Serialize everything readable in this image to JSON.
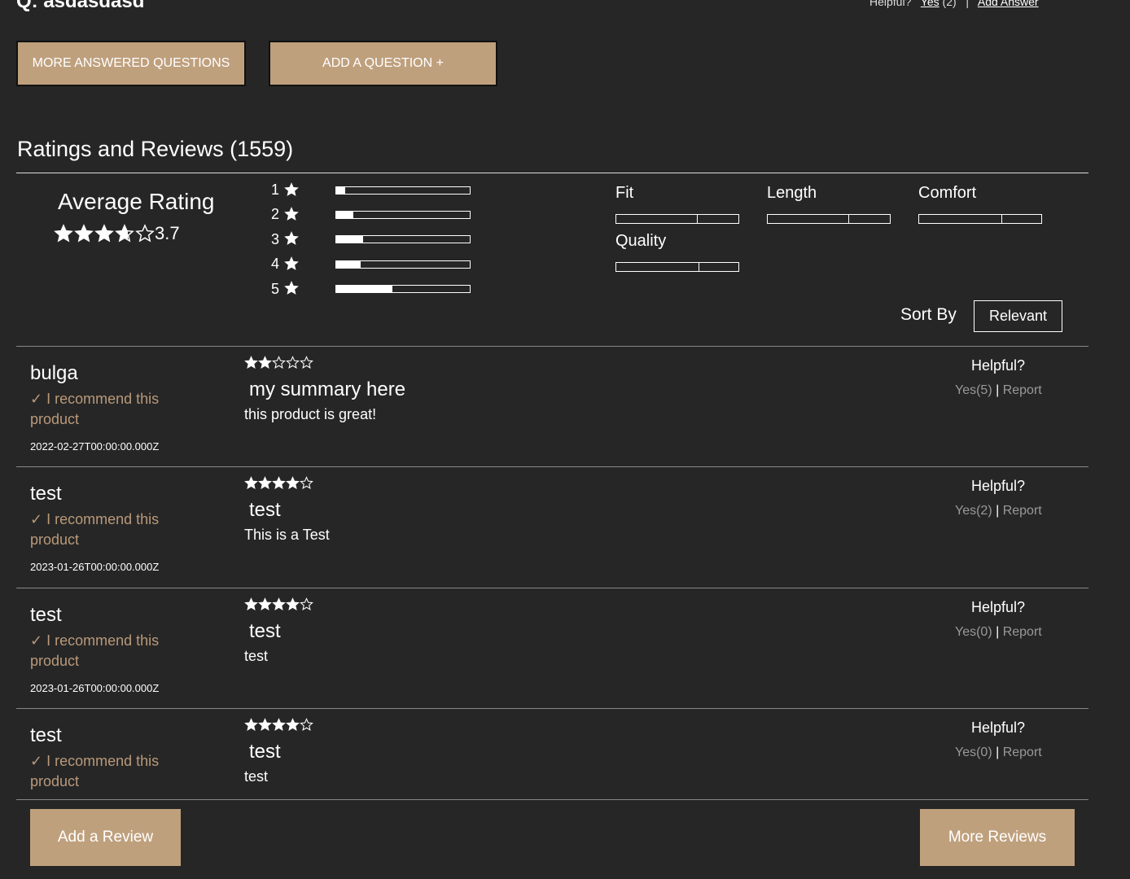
{
  "question": {
    "title": "Q: asdasdasd",
    "helpful_label": "Helpful?",
    "yes_label": "Yes",
    "yes_count": "(2)",
    "separator": "|",
    "add_answer_label": "Add Answer"
  },
  "qa_buttons": {
    "more_answered": "MORE ANSWERED QUESTIONS",
    "add_question": "ADD A QUESTION +"
  },
  "ratings": {
    "title": "Ratings and Reviews (1559)",
    "average_label": "Average Rating",
    "average_value": "3.7",
    "average_numeric": 3.7,
    "breakdown": [
      {
        "label": "1",
        "fraction": 0.07
      },
      {
        "label": "2",
        "fraction": 0.13
      },
      {
        "label": "3",
        "fraction": 0.2
      },
      {
        "label": "4",
        "fraction": 0.18
      },
      {
        "label": "5",
        "fraction": 0.42
      }
    ],
    "characteristics": [
      {
        "label": "Fit",
        "value": 0.66
      },
      {
        "label": "Length",
        "value": 0.66
      },
      {
        "label": "Comfort",
        "value": 0.67
      },
      {
        "label": "Quality",
        "value": 0.67
      }
    ],
    "sort_label": "Sort By",
    "sort_value": "Relevant"
  },
  "reviews": [
    {
      "user": "bulga",
      "recommend": "✓ I recommend this product",
      "date": "2022-02-27T00:00:00.000Z",
      "rating": 2,
      "summary": "my summary here",
      "body": "this product is great!",
      "helpful_label": "Helpful?",
      "yes_text": "Yes(5)",
      "report_label": "Report"
    },
    {
      "user": "test",
      "recommend": "✓ I recommend this product",
      "date": "2023-01-26T00:00:00.000Z",
      "rating": 4,
      "summary": "test",
      "body": "This is a Test",
      "helpful_label": "Helpful?",
      "yes_text": "Yes(2)",
      "report_label": "Report"
    },
    {
      "user": "test",
      "recommend": "✓ I recommend this product",
      "date": "2023-01-26T00:00:00.000Z",
      "rating": 4,
      "summary": "test",
      "body": "test",
      "helpful_label": "Helpful?",
      "yes_text": "Yes(0)",
      "report_label": "Report"
    },
    {
      "user": "test",
      "recommend": "✓ I recommend this product",
      "date": "",
      "rating": 4,
      "summary": "test",
      "body": "test",
      "helpful_label": "Helpful?",
      "yes_text": "Yes(0)",
      "report_label": "Report"
    }
  ],
  "review_buttons": {
    "add_review": "Add a Review",
    "more_reviews": "More Reviews"
  },
  "colors": {
    "background": "#262626",
    "accent": "#bfa07d",
    "recommend": "#b9997a"
  }
}
